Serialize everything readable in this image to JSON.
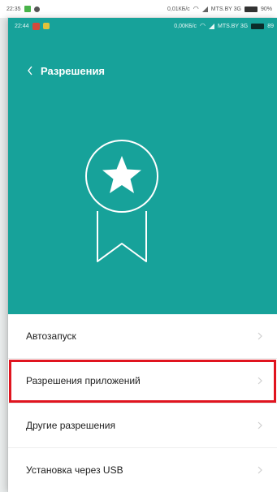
{
  "outer_status": {
    "time": "22:35",
    "net_speed": "0,01КБ/с",
    "carrier": "MTS.BY 3G",
    "battery": "90%"
  },
  "inner_status": {
    "time": "22:44",
    "net_speed": "0,00КБ/с",
    "carrier": "MTS.BY 3G",
    "battery": "89"
  },
  "header": {
    "back_icon": "chevron-left-icon",
    "title": "Разрешения"
  },
  "badge": {
    "icon": "star-badge-icon"
  },
  "colors": {
    "header_bg": "#17a29a",
    "highlight": "#e0141f"
  },
  "menu": {
    "items": [
      {
        "label": "Автозапуск",
        "highlighted": false
      },
      {
        "label": "Разрешения приложений",
        "highlighted": true
      },
      {
        "label": "Другие разрешения",
        "highlighted": false
      },
      {
        "label": "Установка через USB",
        "highlighted": false
      }
    ]
  }
}
